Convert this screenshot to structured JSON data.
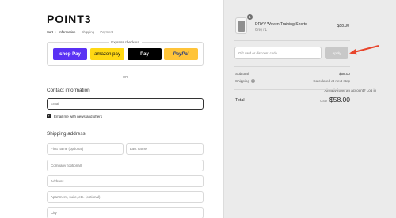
{
  "brand": {
    "logo": "POINT3"
  },
  "breadcrumb": {
    "cart": "Cart",
    "information": "Information",
    "shipping": "Shipping",
    "payment": "Payment",
    "sep": "›"
  },
  "express": {
    "label": "Express checkout",
    "shop_pay": "shop Pay",
    "amazon_pay": "amazon pay",
    "apple_pay": " Pay",
    "paypal": "PayPal"
  },
  "or_label": "OR",
  "contact": {
    "title": "Contact information",
    "login_prompt": "Already have an account? Log in",
    "email_placeholder": "Email",
    "news_checkbox_label": "Email me with news and offers",
    "news_checked": true
  },
  "shipping_address": {
    "title": "Shipping address",
    "first_name_placeholder": "First name (optional)",
    "last_name_placeholder": "Last name",
    "company_placeholder": "Company (optional)",
    "address_placeholder": "Address",
    "apartment_placeholder": "Apartment, suite, etc. (optional)",
    "city_placeholder": "City"
  },
  "order_summary": {
    "item": {
      "quantity": "1",
      "name": "DRYV Woven Training Shorts",
      "variant": "Grey / L",
      "price": "$58.00"
    },
    "discount_placeholder": "Gift card or discount code",
    "apply_label": "Apply",
    "subtotal_label": "Subtotal",
    "subtotal_value": "$58.00",
    "shipping_label": "Shipping",
    "shipping_value": "Calculated at next step",
    "total_label": "Total",
    "currency": "USD",
    "total_value": "$58.00"
  },
  "colors": {
    "shop_pay": "#5a31f4",
    "amazon_pay": "#ffd814",
    "apple_pay": "#000000",
    "paypal": "#ffc439",
    "arrow": "#e8452c",
    "summary_bg": "#ebebeb"
  },
  "icons": {
    "help": "question-circle-icon",
    "arrow": "red-pointer-arrow-icon",
    "check": "checkmark-icon"
  }
}
